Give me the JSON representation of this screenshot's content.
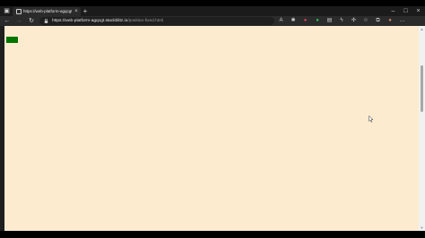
{
  "browser": {
    "tab": {
      "title": "https://web-platform-agqcgt.stackblitz.io",
      "close_glyph": "×"
    },
    "new_tab_glyph": "+",
    "window_controls": {
      "minimize": "–",
      "maximize": "□",
      "close": "×"
    },
    "toolbar": {
      "back_glyph": "←",
      "forward_glyph": "→",
      "refresh_glyph": "↻",
      "lock_glyph": "🔒",
      "url_host": "https://web-platform-agqcgt.stackblitz.io",
      "url_path": "/position-fixed.html"
    },
    "extensions": [
      {
        "name": "read-aloud-icon",
        "glyph": "A",
        "color": "#cfcfcf"
      },
      {
        "name": "extension-gear-icon",
        "glyph": "✱",
        "color": "#cfcfcf"
      },
      {
        "name": "extension-red-icon",
        "glyph": "●",
        "color": "#e0435a"
      },
      {
        "name": "extension-green-icon",
        "glyph": "●",
        "color": "#22c55e"
      },
      {
        "name": "extension-doc-icon",
        "glyph": "▤",
        "color": "#cfcfcf"
      },
      {
        "name": "extension-bolt-icon",
        "glyph": "ϟ",
        "color": "#cfcfcf"
      },
      {
        "name": "extensions-puzzle-icon",
        "glyph": "✣",
        "color": "#cfcfcf"
      },
      {
        "name": "favorites-icon",
        "glyph": "☆",
        "color": "#cfcfcf"
      },
      {
        "name": "collections-icon",
        "glyph": "⧉",
        "color": "#cfcfcf"
      },
      {
        "name": "profile-avatar-icon",
        "glyph": "●",
        "color": "#c7866b"
      },
      {
        "name": "menu-ellipsis-icon",
        "glyph": "…",
        "color": "#cfcfcf"
      }
    ]
  },
  "page": {
    "background": "#fdebd0",
    "box_color": "#007400"
  }
}
